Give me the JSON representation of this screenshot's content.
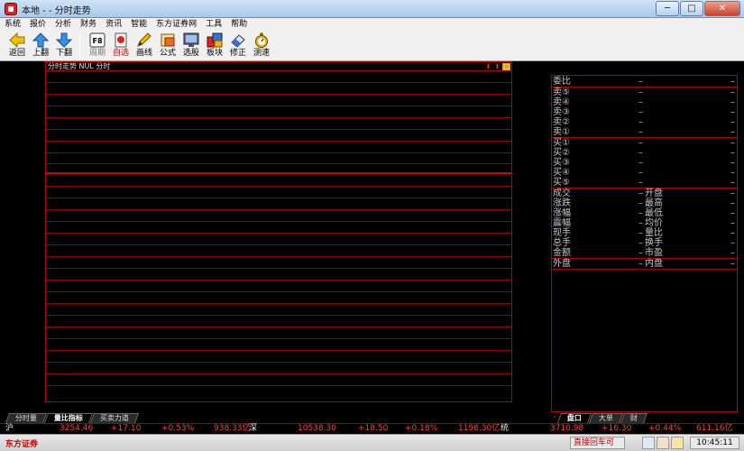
{
  "window": {
    "title": "本地 - - 分时走势",
    "minimize": "─",
    "maximize": "□",
    "close": "✕"
  },
  "menu": [
    "系统",
    "报价",
    "分析",
    "财务",
    "资讯",
    "智能",
    "东方证券网",
    "工具",
    "帮助"
  ],
  "toolbar": [
    {
      "label": "返回",
      "icon": "back-arrow-icon",
      "state": "normal"
    },
    {
      "label": "上翻",
      "icon": "up-arrow-icon",
      "state": "normal"
    },
    {
      "label": "下翻",
      "icon": "down-arrow-icon",
      "state": "normal"
    },
    {
      "label": "周期",
      "icon": "f8-key-icon",
      "state": "disabled",
      "key": "F8"
    },
    {
      "label": "自选",
      "icon": "favorites-icon",
      "state": "active"
    },
    {
      "label": "画线",
      "icon": "pencil-icon",
      "state": "normal"
    },
    {
      "label": "公式",
      "icon": "formula-icon",
      "state": "normal"
    },
    {
      "label": "选股",
      "icon": "monitor-icon",
      "state": "normal"
    },
    {
      "label": "板块",
      "icon": "blocks-icon",
      "state": "normal"
    },
    {
      "label": "修正",
      "icon": "eraser-icon",
      "state": "normal"
    },
    {
      "label": "测速",
      "icon": "stopwatch-icon",
      "state": "normal"
    }
  ],
  "chart": {
    "title": "分时走势  NUL 分时",
    "controls": [
      "⬇",
      "⬆",
      "□"
    ]
  },
  "quote_panel": {
    "header_label": "委比",
    "header_value": "–",
    "header_value2": "–",
    "sell": [
      {
        "label": "卖⑤",
        "price": "–",
        "vol": "–"
      },
      {
        "label": "卖④",
        "price": "–",
        "vol": "–"
      },
      {
        "label": "卖③",
        "price": "–",
        "vol": "–"
      },
      {
        "label": "卖②",
        "price": "–",
        "vol": "–"
      },
      {
        "label": "卖①",
        "price": "–",
        "vol": "–"
      }
    ],
    "buy": [
      {
        "label": "买①",
        "price": "–",
        "vol": "–"
      },
      {
        "label": "买②",
        "price": "–",
        "vol": "–"
      },
      {
        "label": "买③",
        "price": "–",
        "vol": "–"
      },
      {
        "label": "买④",
        "price": "–",
        "vol": "–"
      },
      {
        "label": "买⑤",
        "price": "–",
        "vol": "–"
      }
    ],
    "stats": [
      {
        "k1": "成交",
        "v1": "–",
        "k2": "开盘",
        "v2": "–"
      },
      {
        "k1": "涨跌",
        "v1": "–",
        "k2": "最高",
        "v2": "–"
      },
      {
        "k1": "涨幅",
        "v1": "–",
        "k2": "最低",
        "v2": "–"
      },
      {
        "k1": "震幅",
        "v1": "–",
        "k2": "均价",
        "v2": "–"
      },
      {
        "k1": "现手",
        "v1": "–",
        "k2": "量比",
        "v2": "–"
      },
      {
        "k1": "总手",
        "v1": "–",
        "k2": "换手",
        "v2": "–"
      },
      {
        "k1": "金额",
        "v1": "–",
        "k2": "市盈",
        "v2": "–"
      }
    ],
    "outer": {
      "k1": "外盘",
      "v1": "–",
      "k2": "内盘",
      "v2": "–"
    }
  },
  "bottom_tabs_left": [
    "分时量",
    "量比指标",
    "买卖力道"
  ],
  "bottom_tabs_right": {
    "dot": "·",
    "tabs": [
      "盘口",
      "大单",
      "财"
    ]
  },
  "ticker": {
    "sh_label": "沪",
    "sh_index": "3254.46",
    "sh_change": "+17.10",
    "sh_pct": "+0.53%",
    "sh_amount": "938.33亿",
    "sz_label": "深",
    "sz_index": "10538.30",
    "sz_change": "+18.50",
    "sz_pct": "+0.18%",
    "sz_amount": "1198.30亿",
    "cy_label": "统",
    "cy_index": "3710.98",
    "cy_change": "+16.30",
    "cy_pct": "+0.44%",
    "cy_amount": "611.16亿"
  },
  "status": {
    "brand": "东方证券",
    "connection": "直接回车可",
    "clock": "10:45:11"
  },
  "colors": {
    "grid": "#900000",
    "accent": "#cc0000",
    "up": "#ff3b3b"
  }
}
